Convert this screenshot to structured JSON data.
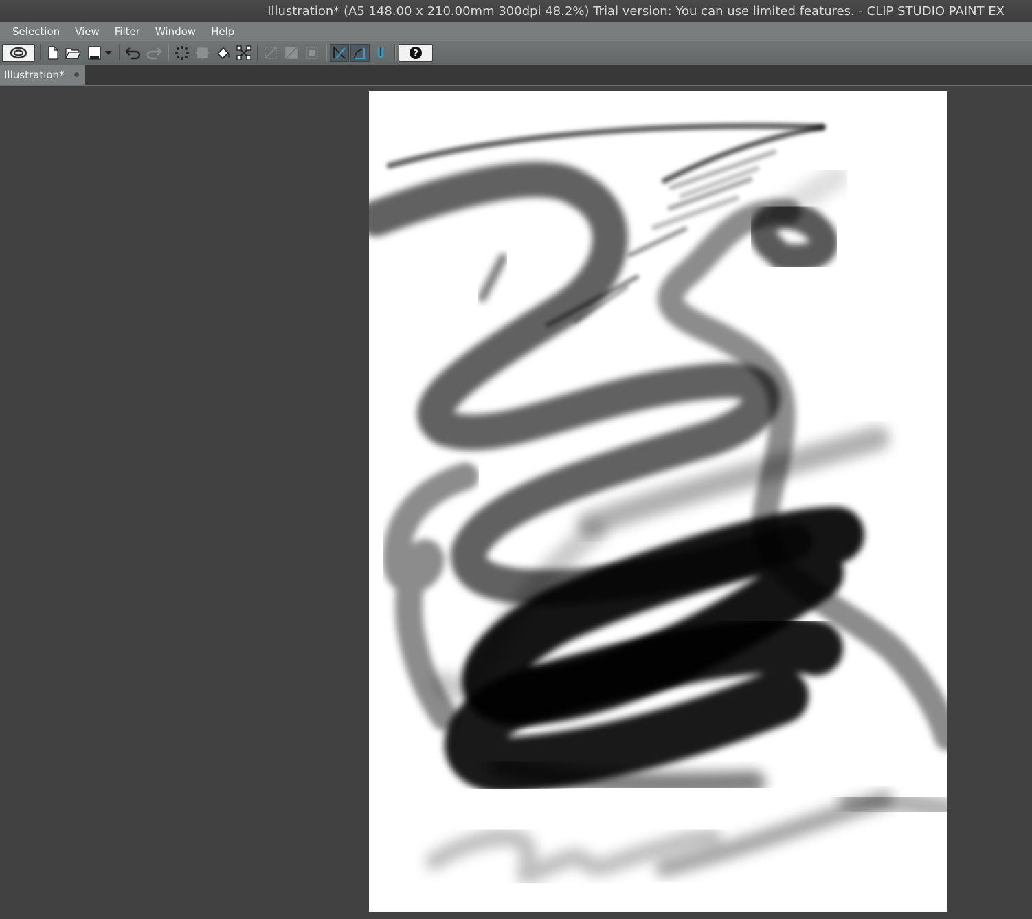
{
  "window": {
    "title": "Illustration* (A5 148.00 x 210.00mm 300dpi 48.2%)  Trial version: You can use limited features. - CLIP STUDIO PAINT EX"
  },
  "menu": {
    "items": [
      "Selection",
      "View",
      "Filter",
      "Window",
      "Help"
    ]
  },
  "toolbar": {
    "buttons": [
      "clip-studio-icon",
      "new-file-icon",
      "open-file-icon",
      "save-icon",
      "save-dropdown-icon",
      "undo-icon",
      "redo-icon",
      "clear-selection-icon",
      "crop-icon",
      "fill-icon",
      "transform-icon",
      "hide-selection-icon",
      "show-selection-icon",
      "selection-area-icon",
      "snap-ruler-icon",
      "snap-special-ruler-icon",
      "snap-grid-icon",
      "help-icon"
    ]
  },
  "tabs": {
    "active": "Illustration*"
  },
  "colors": {
    "menubar": "#787e7e",
    "toolbar": "#666b6b",
    "workspace": "#414141",
    "paper": "#ffffff",
    "stroke": "#000000"
  }
}
